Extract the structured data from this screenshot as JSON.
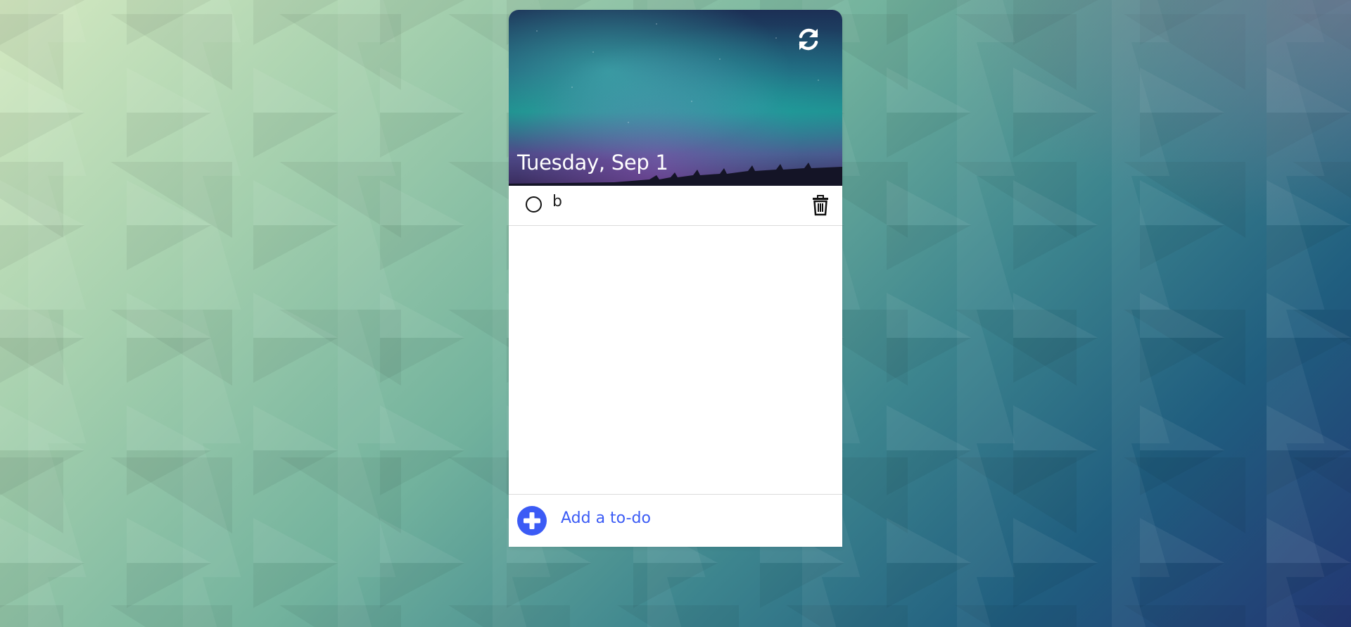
{
  "header": {
    "date": "Tuesday, Sep 1",
    "refresh_icon": "refresh-icon"
  },
  "todos": [
    {
      "text": "b",
      "completed": false
    }
  ],
  "add_bar": {
    "label": "Add a to-do",
    "icon": "plus-icon"
  },
  "colors": {
    "accent": "#3b5bf5",
    "header_text": "#ffffff",
    "item_text": "#222222"
  }
}
